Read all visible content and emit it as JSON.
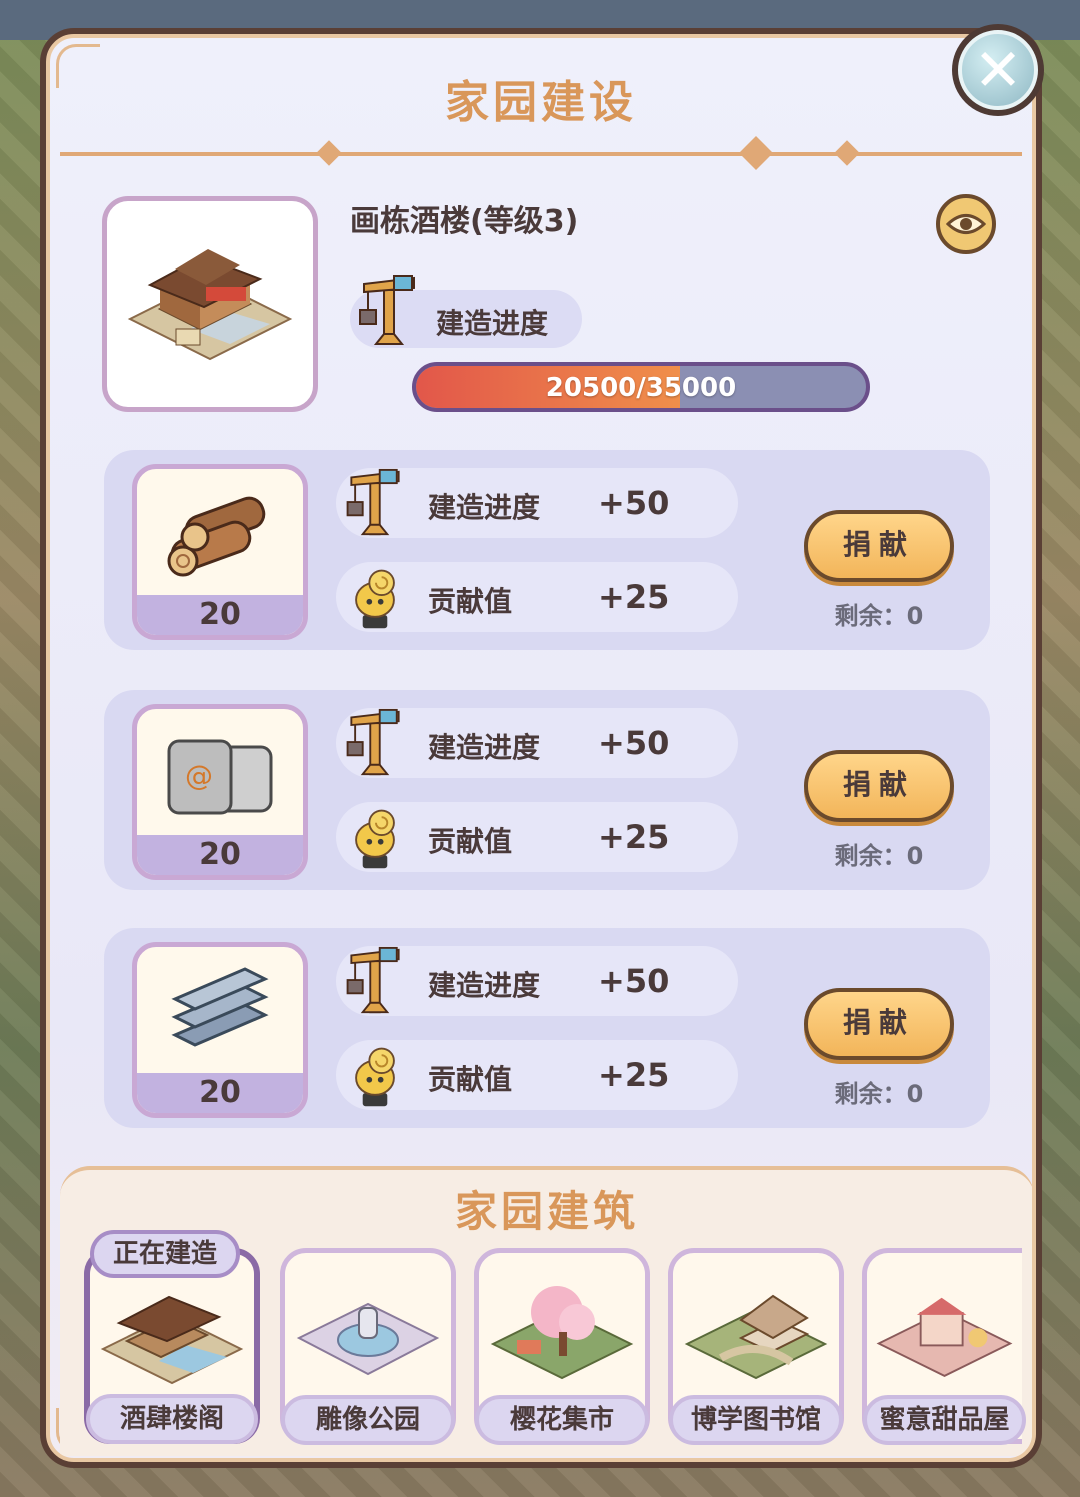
{
  "dialog": {
    "title": "家园建设",
    "close_icon": "close-icon"
  },
  "current_building": {
    "name": "画栋酒楼(等级3)",
    "progress_label": "建造进度",
    "progress_text": "20500/35000",
    "progress_value": 20500,
    "progress_max": 35000,
    "eye_icon": "eye-icon"
  },
  "materials": [
    {
      "name": "wood-logs",
      "count": "20",
      "stats": [
        {
          "label": "建造进度",
          "value": "+50",
          "icon": "crane-icon"
        },
        {
          "label": "贡献值",
          "value": "+25",
          "icon": "snail-trophy-icon"
        }
      ],
      "donate_label": "捐献",
      "remaining": "剩余：0"
    },
    {
      "name": "cement-bags",
      "count": "20",
      "stats": [
        {
          "label": "建造进度",
          "value": "+50",
          "icon": "crane-icon"
        },
        {
          "label": "贡献值",
          "value": "+25",
          "icon": "snail-trophy-icon"
        }
      ],
      "donate_label": "捐献",
      "remaining": "剩余：0"
    },
    {
      "name": "steel-beams",
      "count": "20",
      "stats": [
        {
          "label": "建造进度",
          "value": "+50",
          "icon": "crane-icon"
        },
        {
          "label": "贡献值",
          "value": "+25",
          "icon": "snail-trophy-icon"
        }
      ],
      "donate_label": "捐献",
      "remaining": "剩余：0"
    }
  ],
  "buildings_section": {
    "title": "家园建筑",
    "items": [
      {
        "label": "酒肆楼阁",
        "badge": "正在建造",
        "active": true
      },
      {
        "label": "雕像公园"
      },
      {
        "label": "樱花集市"
      },
      {
        "label": "博学图书馆"
      },
      {
        "label": "蜜意甜品屋"
      }
    ]
  },
  "colors": {
    "title": "#d9975a",
    "progress_fill": "#e2574a",
    "donate_button": "#f2b55a"
  }
}
